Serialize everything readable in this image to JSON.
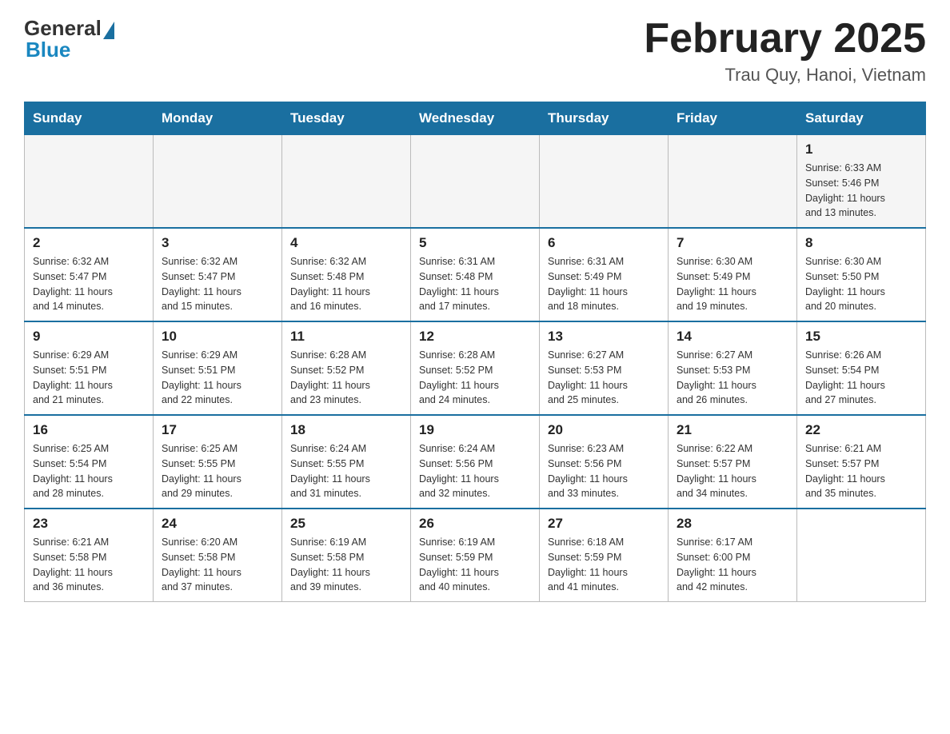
{
  "header": {
    "logo_general": "General",
    "logo_blue": "Blue",
    "month_title": "February 2025",
    "location": "Trau Quy, Hanoi, Vietnam"
  },
  "days_of_week": [
    "Sunday",
    "Monday",
    "Tuesday",
    "Wednesday",
    "Thursday",
    "Friday",
    "Saturday"
  ],
  "weeks": [
    {
      "days": [
        {
          "number": "",
          "info": ""
        },
        {
          "number": "",
          "info": ""
        },
        {
          "number": "",
          "info": ""
        },
        {
          "number": "",
          "info": ""
        },
        {
          "number": "",
          "info": ""
        },
        {
          "number": "",
          "info": ""
        },
        {
          "number": "1",
          "info": "Sunrise: 6:33 AM\nSunset: 5:46 PM\nDaylight: 11 hours\nand 13 minutes."
        }
      ]
    },
    {
      "days": [
        {
          "number": "2",
          "info": "Sunrise: 6:32 AM\nSunset: 5:47 PM\nDaylight: 11 hours\nand 14 minutes."
        },
        {
          "number": "3",
          "info": "Sunrise: 6:32 AM\nSunset: 5:47 PM\nDaylight: 11 hours\nand 15 minutes."
        },
        {
          "number": "4",
          "info": "Sunrise: 6:32 AM\nSunset: 5:48 PM\nDaylight: 11 hours\nand 16 minutes."
        },
        {
          "number": "5",
          "info": "Sunrise: 6:31 AM\nSunset: 5:48 PM\nDaylight: 11 hours\nand 17 minutes."
        },
        {
          "number": "6",
          "info": "Sunrise: 6:31 AM\nSunset: 5:49 PM\nDaylight: 11 hours\nand 18 minutes."
        },
        {
          "number": "7",
          "info": "Sunrise: 6:30 AM\nSunset: 5:49 PM\nDaylight: 11 hours\nand 19 minutes."
        },
        {
          "number": "8",
          "info": "Sunrise: 6:30 AM\nSunset: 5:50 PM\nDaylight: 11 hours\nand 20 minutes."
        }
      ]
    },
    {
      "days": [
        {
          "number": "9",
          "info": "Sunrise: 6:29 AM\nSunset: 5:51 PM\nDaylight: 11 hours\nand 21 minutes."
        },
        {
          "number": "10",
          "info": "Sunrise: 6:29 AM\nSunset: 5:51 PM\nDaylight: 11 hours\nand 22 minutes."
        },
        {
          "number": "11",
          "info": "Sunrise: 6:28 AM\nSunset: 5:52 PM\nDaylight: 11 hours\nand 23 minutes."
        },
        {
          "number": "12",
          "info": "Sunrise: 6:28 AM\nSunset: 5:52 PM\nDaylight: 11 hours\nand 24 minutes."
        },
        {
          "number": "13",
          "info": "Sunrise: 6:27 AM\nSunset: 5:53 PM\nDaylight: 11 hours\nand 25 minutes."
        },
        {
          "number": "14",
          "info": "Sunrise: 6:27 AM\nSunset: 5:53 PM\nDaylight: 11 hours\nand 26 minutes."
        },
        {
          "number": "15",
          "info": "Sunrise: 6:26 AM\nSunset: 5:54 PM\nDaylight: 11 hours\nand 27 minutes."
        }
      ]
    },
    {
      "days": [
        {
          "number": "16",
          "info": "Sunrise: 6:25 AM\nSunset: 5:54 PM\nDaylight: 11 hours\nand 28 minutes."
        },
        {
          "number": "17",
          "info": "Sunrise: 6:25 AM\nSunset: 5:55 PM\nDaylight: 11 hours\nand 29 minutes."
        },
        {
          "number": "18",
          "info": "Sunrise: 6:24 AM\nSunset: 5:55 PM\nDaylight: 11 hours\nand 31 minutes."
        },
        {
          "number": "19",
          "info": "Sunrise: 6:24 AM\nSunset: 5:56 PM\nDaylight: 11 hours\nand 32 minutes."
        },
        {
          "number": "20",
          "info": "Sunrise: 6:23 AM\nSunset: 5:56 PM\nDaylight: 11 hours\nand 33 minutes."
        },
        {
          "number": "21",
          "info": "Sunrise: 6:22 AM\nSunset: 5:57 PM\nDaylight: 11 hours\nand 34 minutes."
        },
        {
          "number": "22",
          "info": "Sunrise: 6:21 AM\nSunset: 5:57 PM\nDaylight: 11 hours\nand 35 minutes."
        }
      ]
    },
    {
      "days": [
        {
          "number": "23",
          "info": "Sunrise: 6:21 AM\nSunset: 5:58 PM\nDaylight: 11 hours\nand 36 minutes."
        },
        {
          "number": "24",
          "info": "Sunrise: 6:20 AM\nSunset: 5:58 PM\nDaylight: 11 hours\nand 37 minutes."
        },
        {
          "number": "25",
          "info": "Sunrise: 6:19 AM\nSunset: 5:58 PM\nDaylight: 11 hours\nand 39 minutes."
        },
        {
          "number": "26",
          "info": "Sunrise: 6:19 AM\nSunset: 5:59 PM\nDaylight: 11 hours\nand 40 minutes."
        },
        {
          "number": "27",
          "info": "Sunrise: 6:18 AM\nSunset: 5:59 PM\nDaylight: 11 hours\nand 41 minutes."
        },
        {
          "number": "28",
          "info": "Sunrise: 6:17 AM\nSunset: 6:00 PM\nDaylight: 11 hours\nand 42 minutes."
        },
        {
          "number": "",
          "info": ""
        }
      ]
    }
  ]
}
